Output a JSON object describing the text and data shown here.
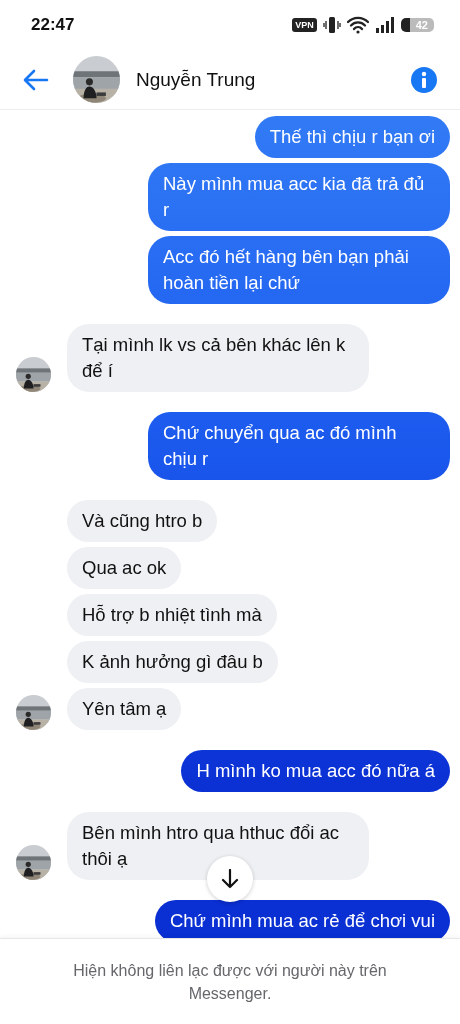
{
  "status_bar": {
    "time": "22:47",
    "vpn": "VPN",
    "battery": "42"
  },
  "header": {
    "contact_name": "Nguyễn Trung"
  },
  "messages": [
    {
      "kind": "sent",
      "text": "Thế thì chịu r bạn ơi"
    },
    {
      "kind": "sent",
      "text": "Này mình mua acc kia đã trả đủ r"
    },
    {
      "kind": "sent",
      "text": "Acc đó hết hàng bên bạn phải hoàn tiền lại chứ"
    },
    {
      "kind": "received",
      "text": "Tại mình lk vs cả bên khác lên k để í",
      "avatar": true
    },
    {
      "kind": "sent",
      "text": "Chứ chuyển qua ac đó mình chịu r"
    },
    {
      "kind": "received",
      "text": "Và cũng htro b",
      "avatar": false
    },
    {
      "kind": "received",
      "text": "Qua ac ok",
      "avatar": false
    },
    {
      "kind": "received",
      "text": "Hỗ trợ b nhiệt tình mà",
      "avatar": false
    },
    {
      "kind": "received",
      "text": "K ảnh hưởng gì đâu b",
      "avatar": false
    },
    {
      "kind": "received",
      "text": "Yên tâm ạ",
      "avatar": true
    },
    {
      "kind": "sent",
      "text": "H mình ko mua acc đó nữa á"
    },
    {
      "kind": "received",
      "text": "Bên mình htro qua hthuc đổi ac thôi ạ",
      "avatar": true
    },
    {
      "kind": "sent",
      "text": "Chứ mình mua ac rẻ để chơi vui"
    }
  ],
  "footer": {
    "notice": "Hiện không liên lạc được với người này trên Messenger."
  }
}
